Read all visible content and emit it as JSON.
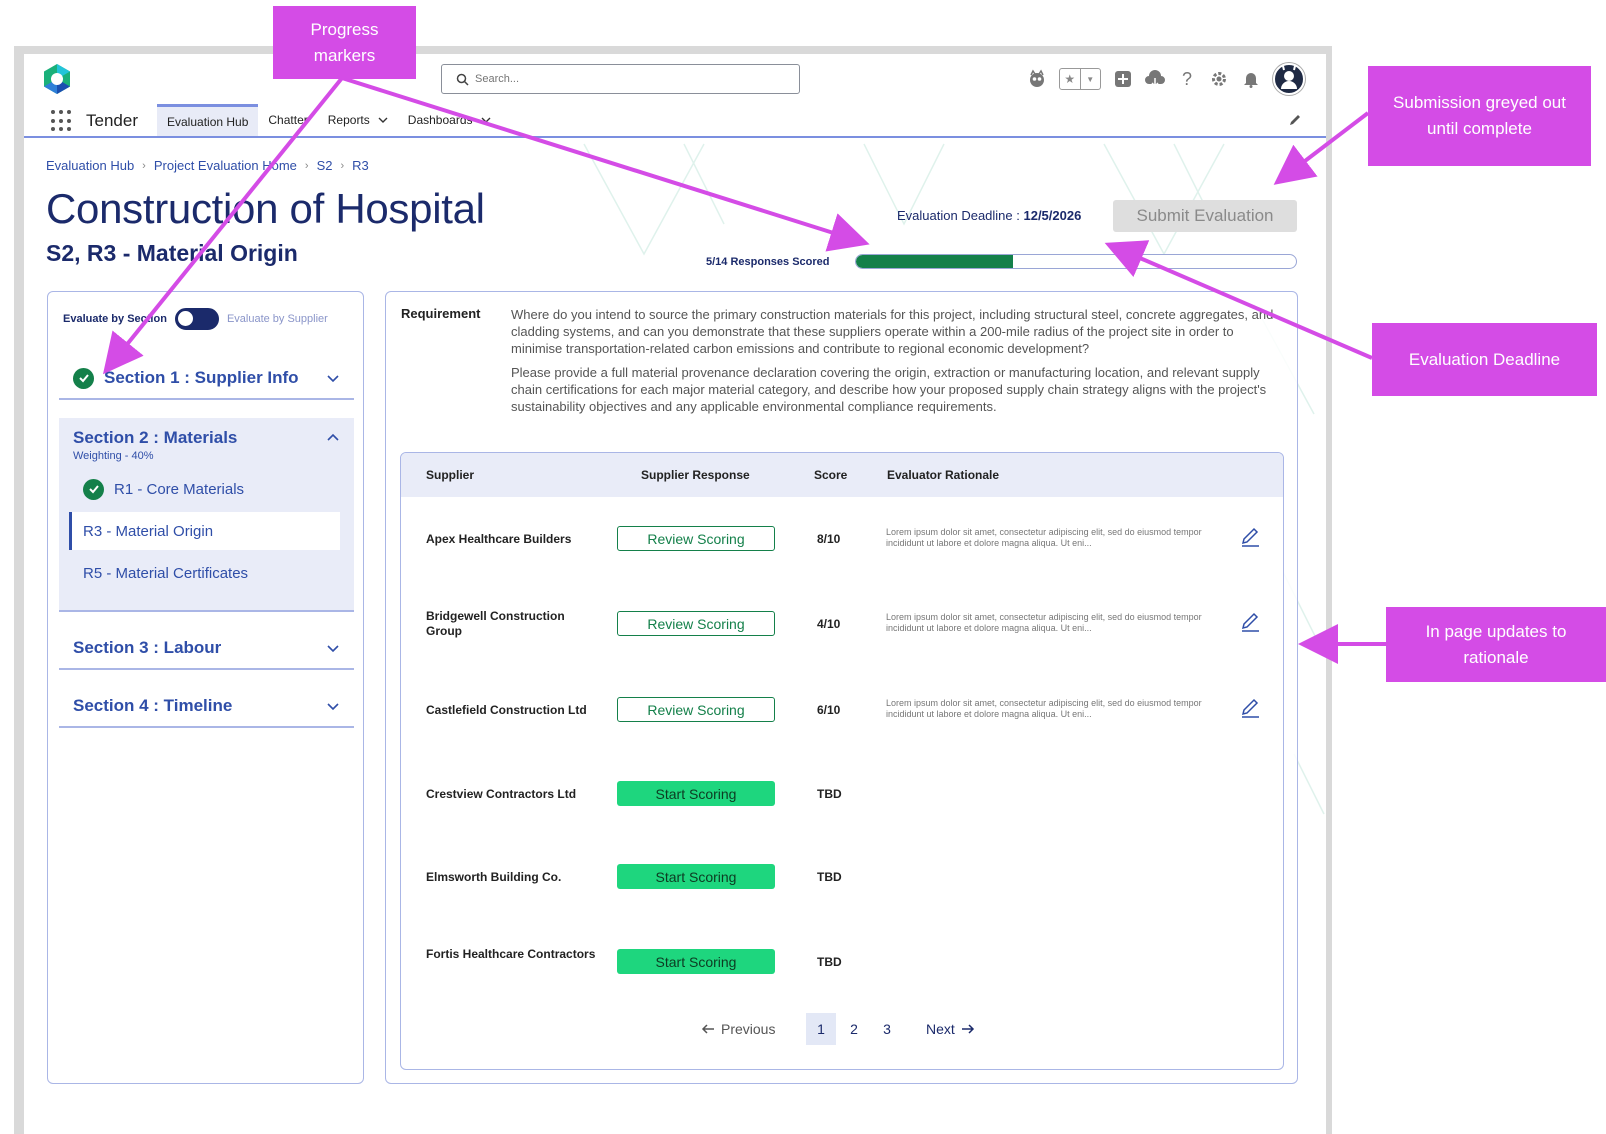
{
  "header": {
    "search_placeholder": "Search...",
    "app_name": "Tender",
    "nav": [
      {
        "label": "Evaluation Hub"
      },
      {
        "label": "Chatter"
      },
      {
        "label": "Reports"
      },
      {
        "label": "Dashboards"
      }
    ]
  },
  "breadcrumb": [
    "Evaluation Hub",
    "Project Evaluation Home",
    "S2",
    "R3"
  ],
  "page": {
    "title": "Construction of Hospital",
    "subtitle": "S2, R3 - Material Origin",
    "deadline_label": "Evaluation Deadline : ",
    "deadline_value": "12/5/2026",
    "submit_label": "Submit Evaluation",
    "progress_label": "5/14 Responses Scored",
    "progress_fraction": 0.357
  },
  "sidebar": {
    "toggle_on": "Evaluate by Section",
    "toggle_off": "Evaluate by Supplier",
    "sections": [
      {
        "title": "Section 1 : Supplier Info"
      },
      {
        "title": "Section 2 : Materials",
        "weighting": "Weighting - 40%",
        "items": [
          "R1 - Core Materials",
          "R3 - Material Origin",
          "R5 - Material Certificates"
        ]
      },
      {
        "title": "Section 3 : Labour"
      },
      {
        "title": "Section 4 : Timeline"
      }
    ]
  },
  "requirement": {
    "label": "Requirement",
    "p1": "Where do you intend to source the primary construction materials for this project, including structural steel, concrete aggregates, and cladding systems, and can you demonstrate that these suppliers operate within a 200-mile radius of the project site in order to minimise transportation-related carbon emissions and contribute to regional economic development?",
    "p2": "Please provide a full material provenance declaration covering the origin, extraction or manufacturing location, and relevant supply chain certifications for each major material category, and describe how your proposed supply chain strategy aligns with the project's sustainability objectives and any applicable environmental compliance requirements."
  },
  "table": {
    "headers": [
      "Supplier",
      "Supplier Response",
      "Score",
      "Evaluator Rationale"
    ],
    "rows": [
      {
        "supplier": "Apex Healthcare Builders",
        "action": "Review Scoring",
        "score": "8/10",
        "rationale": "Lorem ipsum dolor sit amet, consectetur adipiscing elit, sed do eiusmod tempor incididunt ut labore et dolore magna aliqua. Ut eni..."
      },
      {
        "supplier": "Bridgewell Construction Group",
        "action": "Review Scoring",
        "score": "4/10",
        "rationale": "Lorem ipsum dolor sit amet, consectetur adipiscing elit, sed do eiusmod tempor incididunt ut labore et dolore magna aliqua. Ut eni..."
      },
      {
        "supplier": "Castlefield Construction Ltd",
        "action": "Review Scoring",
        "score": "6/10",
        "rationale": "Lorem ipsum dolor sit amet, consectetur adipiscing elit, sed do eiusmod tempor incididunt ut labore et dolore magna aliqua. Ut eni..."
      },
      {
        "supplier": "Crestview Contractors Ltd",
        "action": "Start Scoring",
        "score": "TBD",
        "rationale": ""
      },
      {
        "supplier": "Elmsworth Building Co.",
        "action": "Start Scoring",
        "score": "TBD",
        "rationale": ""
      },
      {
        "supplier": "Fortis Healthcare Contractors",
        "action": "Start Scoring",
        "score": "TBD",
        "rationale": ""
      }
    ]
  },
  "pagination": {
    "prev": "Previous",
    "pages": [
      "1",
      "2",
      "3"
    ],
    "next": "Next"
  },
  "annotations": {
    "progress": "Progress markers",
    "submission": "Submission greyed out until complete",
    "deadline": "Evaluation Deadline",
    "rationale": "In page updates to rationale"
  },
  "colors": {
    "accent": "#2f4ea8",
    "success": "#14804a",
    "start_button": "#1ed67e",
    "annotation": "#d44ce6"
  }
}
